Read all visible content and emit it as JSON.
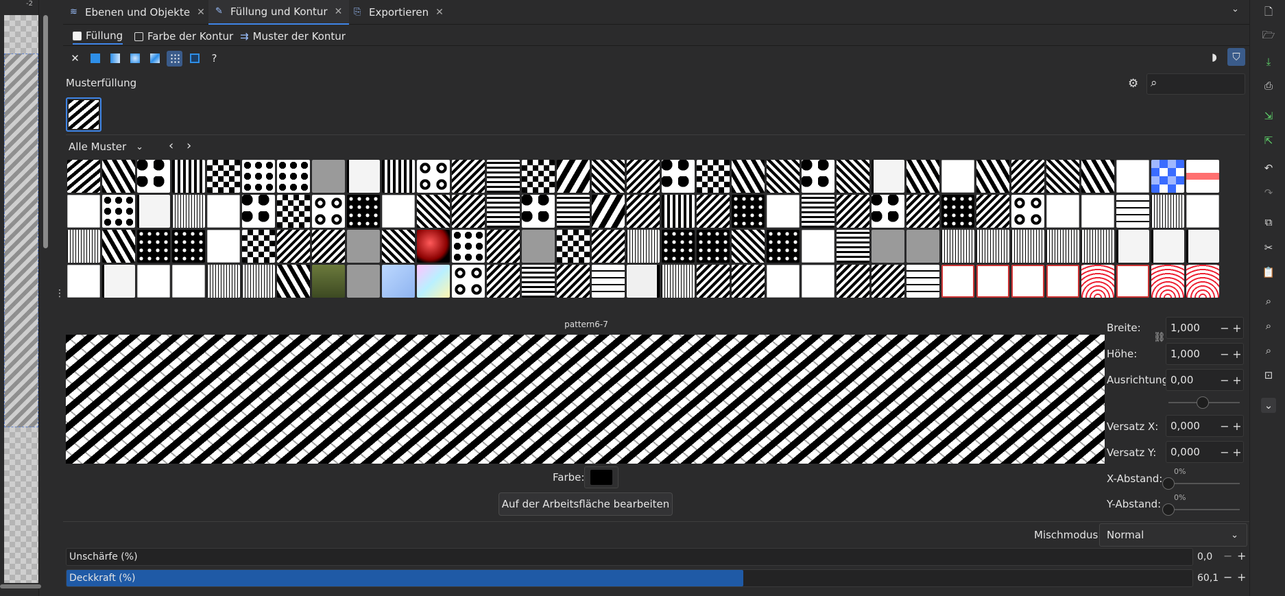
{
  "canvas": {
    "ruler_label": "-2"
  },
  "tabs": [
    {
      "label": "Ebenen und Objekte",
      "icon": "layers-icon",
      "active": false
    },
    {
      "label": "Füllung und Kontur",
      "icon": "brush-icon",
      "active": true
    },
    {
      "label": "Exportieren",
      "icon": "export-icon",
      "active": false
    }
  ],
  "subtabs": [
    {
      "label": "Füllung",
      "active": true
    },
    {
      "label": "Farbe der Kontur",
      "active": false
    },
    {
      "label": "Muster der Kontur",
      "active": false
    }
  ],
  "fill_types": [
    "no-paint",
    "flat-color",
    "linear-gradient",
    "radial-gradient",
    "mesh-gradient",
    "pattern",
    "swatch",
    "unset"
  ],
  "fill_types_glyphs": {
    "none": "✕",
    "unset": "?"
  },
  "pattern_fill": {
    "label": "Musterfüllung",
    "search_placeholder": "",
    "collection": "Alle Muster",
    "selected_name": "pattern6-7"
  },
  "params": {
    "width_label": "Breite:",
    "width": "1,000",
    "height_label": "Höhe:",
    "height": "1,000",
    "orientation_label": "Ausrichtung",
    "orientation": "0,00",
    "offset_x_label": "Versatz X:",
    "offset_x": "0,000",
    "offset_y_label": "Versatz Y:",
    "offset_y": "0,000",
    "gap_x_label": "X-Abstand:",
    "gap_x": "0%",
    "gap_y_label": "Y-Abstand:",
    "gap_y": "0%"
  },
  "color": {
    "label": "Farbe:",
    "value": "#000000"
  },
  "edit_button": "Auf der Arbeitsfläche bearbeiten",
  "blend": {
    "label": "Mischmodus:",
    "value": "Normal"
  },
  "blur": {
    "label": "Unschärfe (%)",
    "value": "0,0",
    "percent": 0
  },
  "opacity": {
    "label": "Deckkraft (%)",
    "value": "60,1",
    "percent": 60.1
  },
  "colors": {
    "accent": "#3e84e6",
    "selection": "#1f5aa6",
    "background": "#2b2b2c"
  }
}
